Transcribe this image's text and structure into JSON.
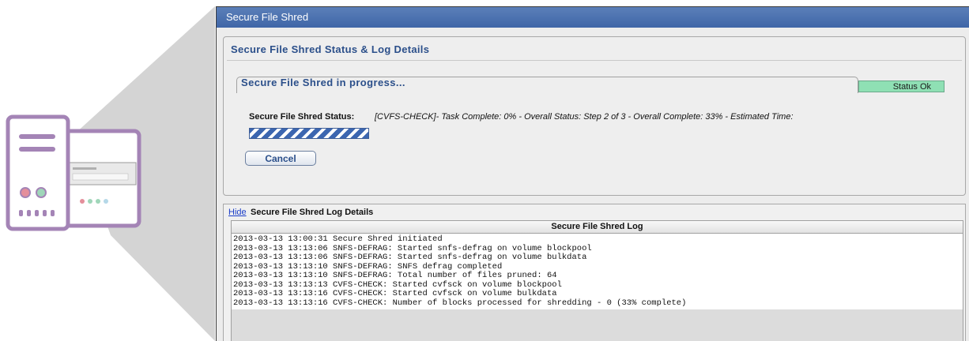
{
  "window": {
    "title": "Secure File Shred"
  },
  "status_panel": {
    "title": "Secure File Shred Status & Log Details",
    "group_title": "Secure File Shred in progress...",
    "status_badge": "Status Ok",
    "status_label": "Secure File Shred Status:",
    "status_text": "[CVFS-CHECK]- Task Complete: 0% - Overall Status: Step 2 of 3 - Overall Complete: 33% - Estimated Time:",
    "cancel_label": "Cancel"
  },
  "log_panel": {
    "hide_label": "Hide",
    "title": "Secure File Shred Log Details",
    "column_header": "Secure File Shred Log",
    "lines": [
      "2013-03-13 13:00:31 Secure Shred initiated",
      "2013-03-13 13:13:06 SNFS-DEFRAG: Started snfs-defrag on volume blockpool",
      "2013-03-13 13:13:06 SNFS-DEFRAG: Started snfs-defrag on volume bulkdata",
      "2013-03-13 13:13:10 SNFS-DEFRAG: SNFS defrag completed",
      "2013-03-13 13:13:10 SNFS-DEFRAG: Total number of files pruned: 64",
      "2013-03-13 13:13:13 CVFS-CHECK: Started cvfsck on volume blockpool",
      "2013-03-13 13:13:16 CVFS-CHECK: Started cvfsck on volume bulkdata",
      "2013-03-13 13:13:16 CVFS-CHECK: Number of blocks processed for shredding - 0 (33% complete)"
    ]
  },
  "colors": {
    "titlebar": "#4a70ae",
    "accent_text": "#2b4f8a",
    "status_ok": "#8fe0b4",
    "callout_purple": "#a484b6"
  },
  "icons": {
    "computer": "desktop-tower-icon"
  }
}
